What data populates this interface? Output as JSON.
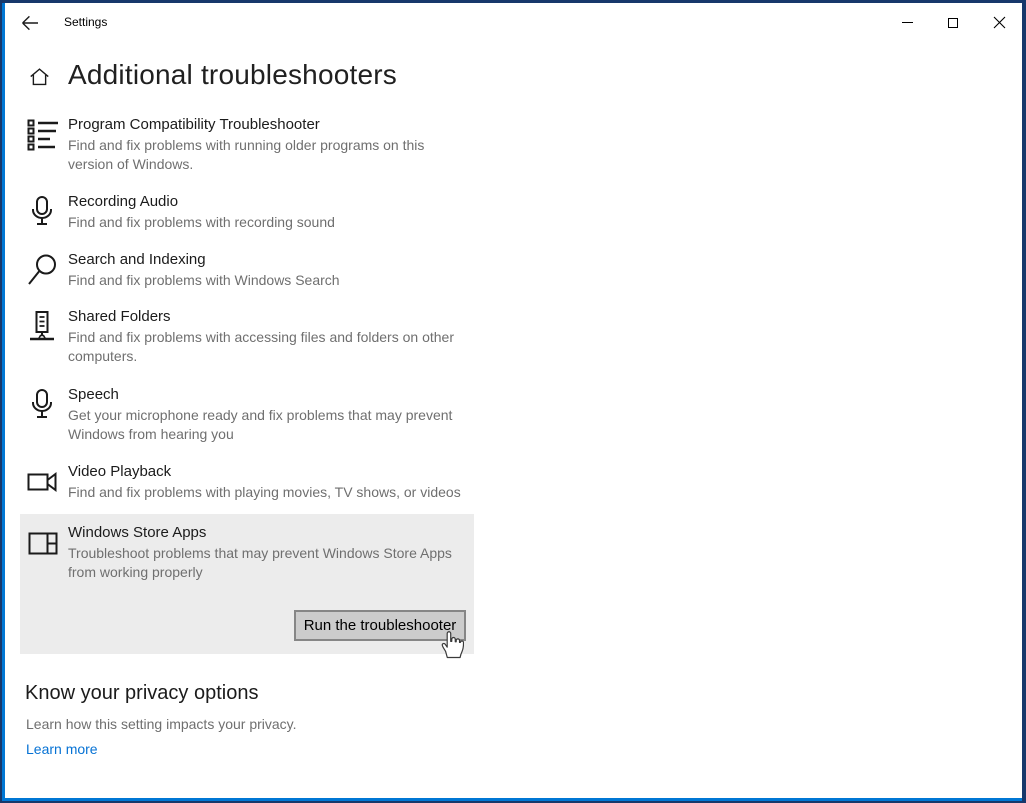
{
  "window": {
    "title": "Settings",
    "controls": {
      "minimize": "minimize-icon",
      "maximize": "maximize-icon",
      "close": "close-icon"
    }
  },
  "page": {
    "title": "Additional troubleshooters"
  },
  "troubleshooters": [
    {
      "icon": "program-list-icon",
      "name": "Program Compatibility Troubleshooter",
      "description": "Find and fix problems with running older programs on this version of Windows."
    },
    {
      "icon": "microphone-icon",
      "name": "Recording Audio",
      "description": "Find and fix problems with recording sound"
    },
    {
      "icon": "search-icon",
      "name": "Search and Indexing",
      "description": "Find and fix problems with Windows Search"
    },
    {
      "icon": "shared-folders-icon",
      "name": "Shared Folders",
      "description": "Find and fix problems with accessing files and folders on other computers."
    },
    {
      "icon": "microphone-icon",
      "name": "Speech",
      "description": "Get your microphone ready and fix problems that may prevent Windows from hearing you"
    },
    {
      "icon": "video-camera-icon",
      "name": "Video Playback",
      "description": "Find and fix problems with playing movies, TV shows, or videos"
    },
    {
      "icon": "store-apps-icon",
      "name": "Windows Store Apps",
      "description": "Troubleshoot problems that may prevent Windows Store Apps from working properly",
      "button_label": "Run the troubleshooter",
      "selected": true
    }
  ],
  "privacy": {
    "heading": "Know your privacy options",
    "text": "Learn how this setting impacts your privacy.",
    "link": "Learn more"
  },
  "colors": {
    "frame": "#17386b",
    "accent": "#0077d4",
    "selected_panel": "#ececec",
    "button_face": "#cccccc",
    "button_border": "#868686",
    "link": "#0672d4",
    "title_text": "#1b1b1b",
    "muted_text": "#6f6f6f"
  }
}
